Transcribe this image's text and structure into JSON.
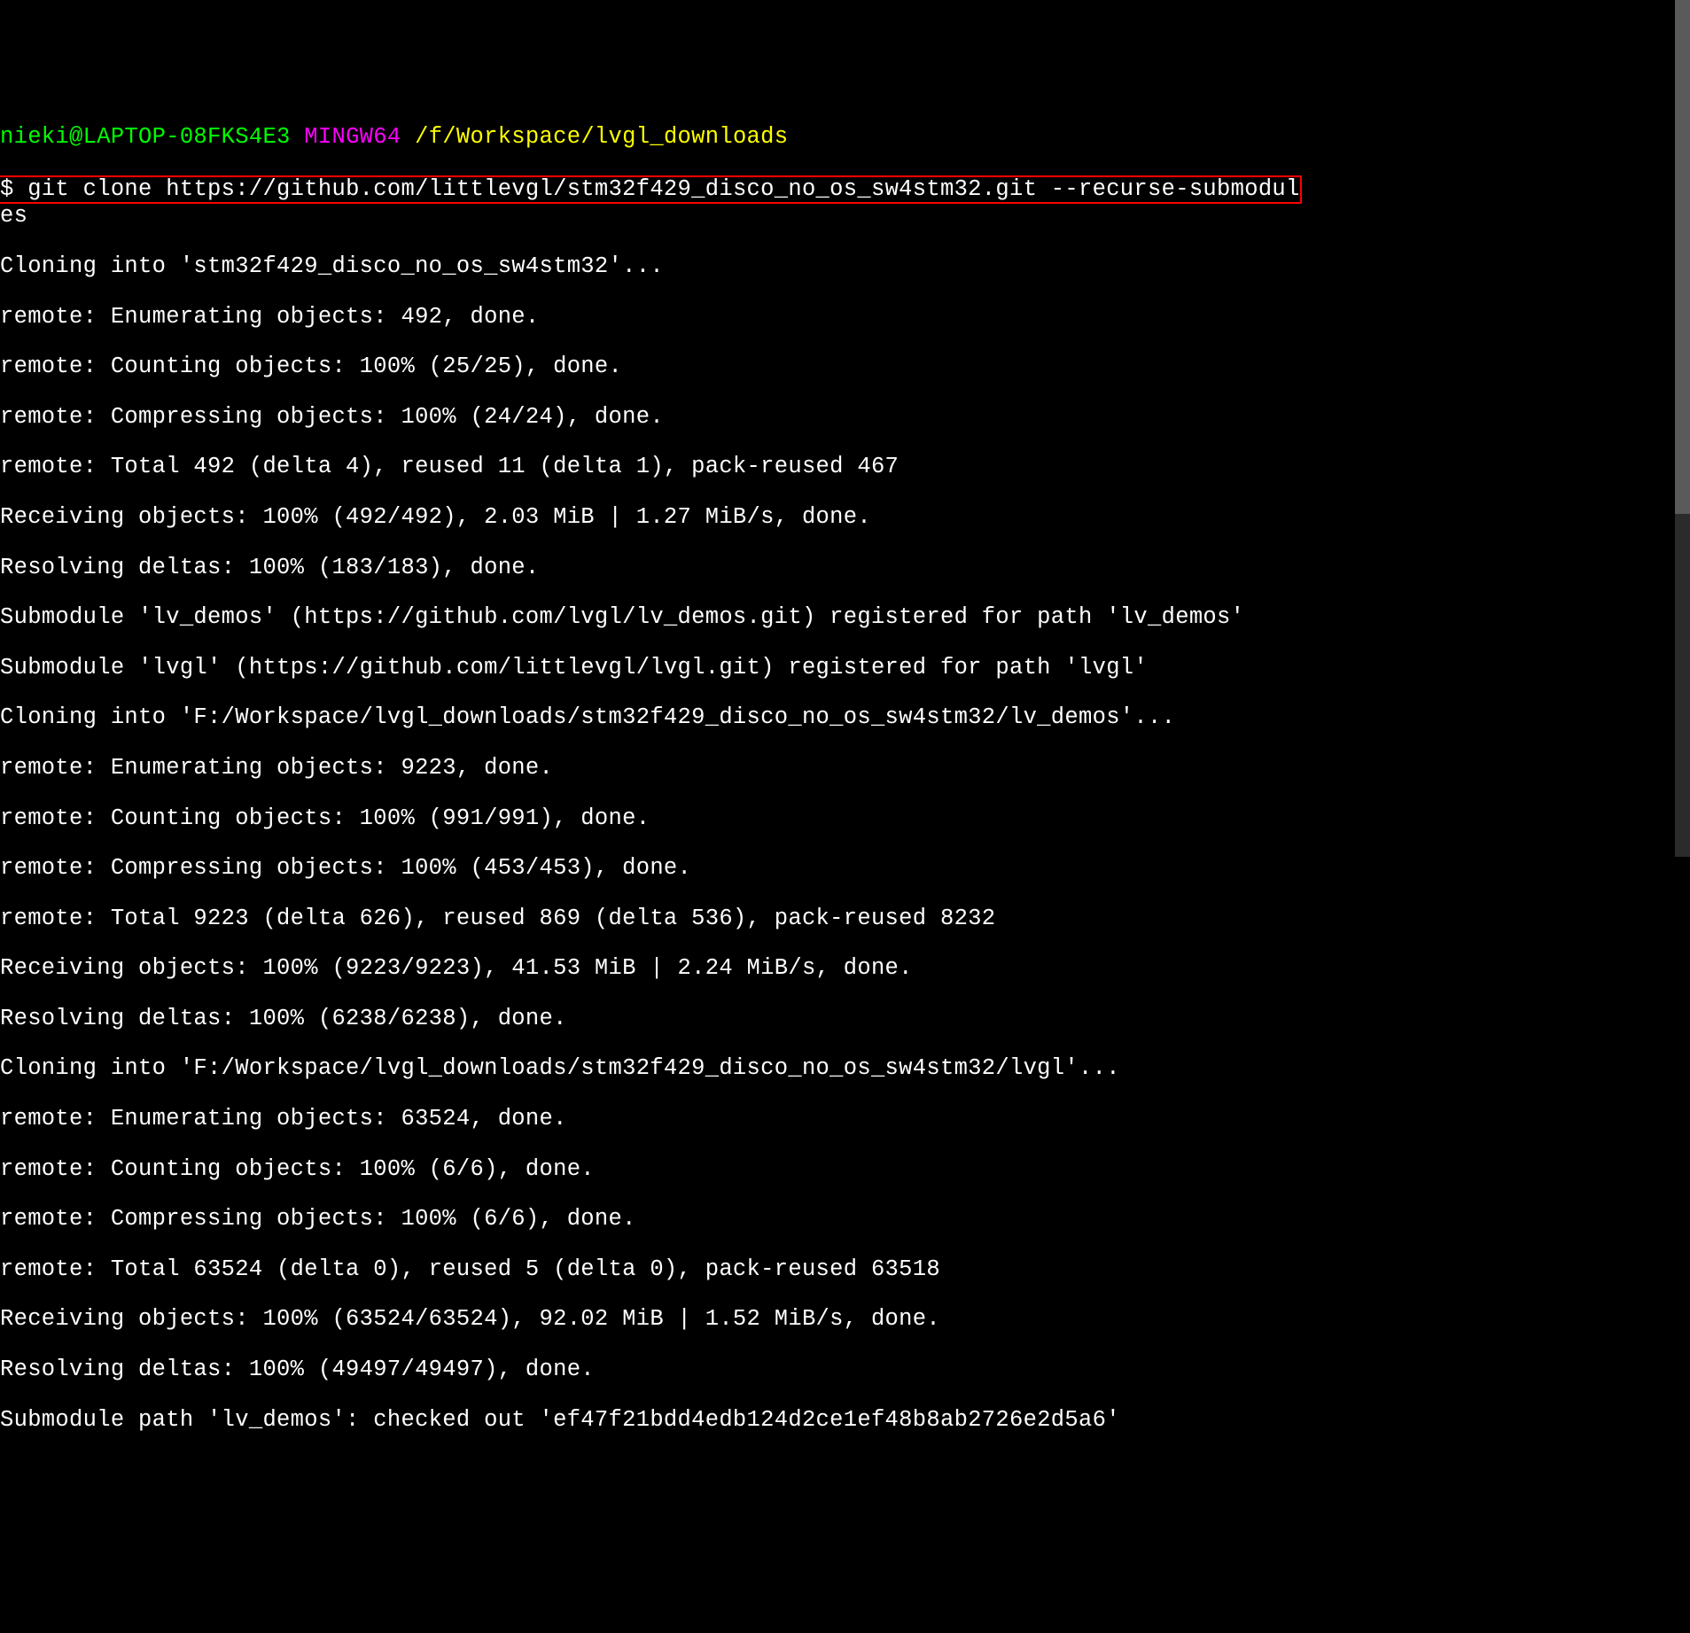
{
  "prompt": {
    "user": "nieki@LAPTOP-08FKS4E3",
    "env": "MINGW64",
    "path": "/f/Workspace/lvgl_downloads",
    "symbol": "$"
  },
  "command": {
    "line1": " git clone https://github.com/littlevgl/stm32f429_disco_no_os_sw4stm32.git --recurse-submodul",
    "line2": "es"
  },
  "output": {
    "l01": "Cloning into 'stm32f429_disco_no_os_sw4stm32'...",
    "l02": "remote: Enumerating objects: 492, done.",
    "l03": "remote: Counting objects: 100% (25/25), done.",
    "l04": "remote: Compressing objects: 100% (24/24), done.",
    "l05": "remote: Total 492 (delta 4), reused 11 (delta 1), pack-reused 467",
    "l06": "Receiving objects: 100% (492/492), 2.03 MiB | 1.27 MiB/s, done.",
    "l07": "Resolving deltas: 100% (183/183), done.",
    "l08": "Submodule 'lv_demos' (https://github.com/lvgl/lv_demos.git) registered for path 'lv_demos'",
    "l09": "Submodule 'lvgl' (https://github.com/littlevgl/lvgl.git) registered for path 'lvgl'",
    "l10": "Cloning into 'F:/Workspace/lvgl_downloads/stm32f429_disco_no_os_sw4stm32/lv_demos'...",
    "l11": "remote: Enumerating objects: 9223, done.",
    "l12": "remote: Counting objects: 100% (991/991), done.",
    "l13": "remote: Compressing objects: 100% (453/453), done.",
    "l14": "remote: Total 9223 (delta 626), reused 869 (delta 536), pack-reused 8232",
    "l15": "Receiving objects: 100% (9223/9223), 41.53 MiB | 2.24 MiB/s, done.",
    "l16": "Resolving deltas: 100% (6238/6238), done.",
    "l17": "Cloning into 'F:/Workspace/lvgl_downloads/stm32f429_disco_no_os_sw4stm32/lvgl'...",
    "l18": "remote: Enumerating objects: 63524, done.",
    "l19": "remote: Counting objects: 100% (6/6), done.",
    "l20": "remote: Compressing objects: 100% (6/6), done.",
    "l21": "remote: Total 63524 (delta 0), reused 5 (delta 0), pack-reused 63518",
    "l22": "Receiving objects: 100% (63524/63524), 92.02 MiB | 1.52 MiB/s, done.",
    "l23": "Resolving deltas: 100% (49497/49497), done.",
    "l24": "Submodule path 'lv_demos': checked out 'ef47f21bdd4edb124d2ce1ef48b8ab2726e2d5a6'"
  }
}
